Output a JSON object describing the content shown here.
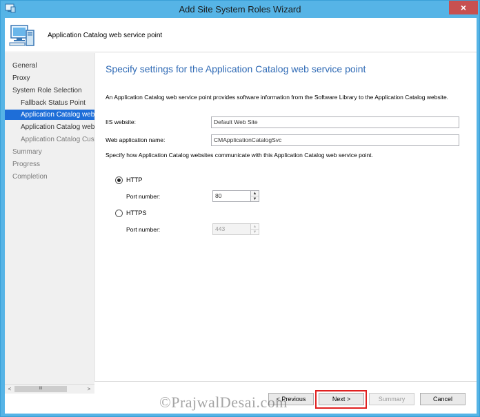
{
  "window": {
    "title": "Add Site System Roles Wizard",
    "close_label": "×"
  },
  "header": {
    "title": "Application Catalog web service point"
  },
  "sidebar": {
    "items": [
      {
        "label": "General",
        "state": "active"
      },
      {
        "label": "Proxy",
        "state": "active"
      },
      {
        "label": "System Role Selection",
        "state": "active"
      },
      {
        "label": "Fallback Status Point",
        "state": "active"
      },
      {
        "label": "Application Catalog web",
        "state": "selected"
      },
      {
        "label": "Application Catalog webs",
        "state": "active"
      },
      {
        "label": "Application Catalog Cust",
        "state": "disabled"
      },
      {
        "label": "Summary",
        "state": "disabled"
      },
      {
        "label": "Progress",
        "state": "disabled"
      },
      {
        "label": "Completion",
        "state": "disabled"
      }
    ]
  },
  "main": {
    "title": "Specify settings for the Application Catalog web service point",
    "description": "An Application Catalog web service point provides software information from the Software Library to the Application Catalog website.",
    "iis_label": "IIS website:",
    "iis_value": "Default Web Site",
    "webapp_label": "Web application name:",
    "webapp_value": "CMApplicationCatalogSvc",
    "comm_desc": "Specify how Application Catalog websites communicate with this Application Catalog web service point.",
    "http": {
      "label": "HTTP",
      "selected": true,
      "port_label": "Port number:",
      "port_value": "80"
    },
    "https": {
      "label": "HTTPS",
      "selected": false,
      "port_label": "Port number:",
      "port_value": "443"
    }
  },
  "footer": {
    "previous_label": "< Previous",
    "next_label": "Next >",
    "summary_label": "Summary",
    "cancel_label": "Cancel"
  },
  "scrollbar": {
    "left_arrow": "<",
    "thumb_label": "III",
    "right_arrow": ">"
  },
  "watermark": "©PrajwalDesai.com",
  "colors": {
    "title_bar": "#56b4e6",
    "accent_title": "#2f6ab5",
    "selection": "#1e6ed8",
    "highlight_box": "#e02020"
  }
}
